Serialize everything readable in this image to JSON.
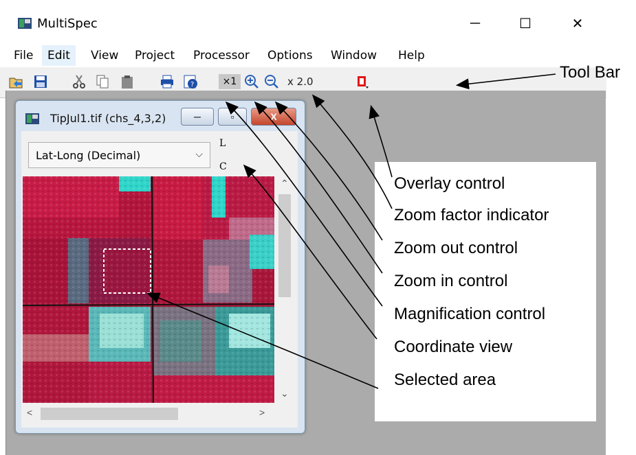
{
  "app": {
    "title": "MultiSpec",
    "controls": {
      "minimize": "─",
      "maximize": "☐",
      "close": "✕"
    }
  },
  "menu": {
    "items": [
      "File",
      "Edit",
      "View",
      "Project",
      "Processor",
      "Options",
      "Window",
      "Help"
    ]
  },
  "toolbar": {
    "icons": [
      "open-file-icon",
      "save-icon",
      "cut-icon",
      "copy-icon",
      "paste-icon",
      "print-icon",
      "help-icon"
    ],
    "magnification": "×1",
    "zoom_factor": "x 2.0"
  },
  "image_window": {
    "title": "TipJul1.tif (chs_4,3,2)",
    "coordinate_system": "Lat-Long (Decimal)",
    "line_label": "L",
    "column_label": "C",
    "controls": {
      "minimize": "─",
      "maximize": "▫",
      "close": "X"
    }
  },
  "annotations": {
    "tool_bar": "Tool Bar",
    "labels": [
      "Overlay control",
      "Zoom factor indicator",
      "Zoom out control",
      "Zoom in control",
      "Magnification control",
      "Coordinate view",
      "Selected area"
    ]
  },
  "colors": {
    "field_red": "#c0173a",
    "field_cyan": "#2fd5c9",
    "overlay_red": "#e01818",
    "client_gray": "#ababab"
  }
}
